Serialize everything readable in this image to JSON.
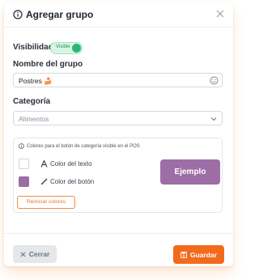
{
  "modal": {
    "title": "Agregar grupo",
    "title_icon": "info-icon",
    "close_icon": "close-icon"
  },
  "visibility": {
    "label": "Visibilidad",
    "toggle_text": "Visible",
    "toggle_on": true
  },
  "group_name": {
    "label": "Nombre del grupo",
    "value": "Postres 🍰",
    "emoji_icon": "emoji-smile-icon"
  },
  "category": {
    "label": "Categoría",
    "selected": "Alimentos",
    "chevron_icon": "chevron-down-icon"
  },
  "colors": {
    "hint": "Colores para el botón de categoría visible en el POS",
    "text_color_label": "Color del texto",
    "text_color": "#ffffff",
    "button_color_label": "Color del botón",
    "button_color": "#9d6ea6",
    "preview_label": "Ejemplo",
    "reset_label": "Reiniciar colores"
  },
  "footer": {
    "cancel_label": "Cerrar",
    "save_label": "Guardar"
  },
  "accent": "#f26b1d"
}
